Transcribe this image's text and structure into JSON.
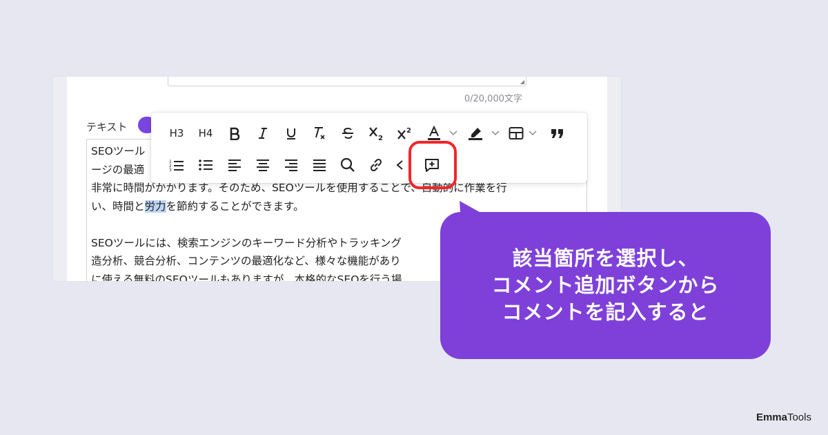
{
  "editor_panel": {
    "char_count": "0/20,000文字",
    "field_label": "テキスト",
    "paragraphs": [
      {
        "lines": [
          "SEOツール",
          "ージの最適",
          "非常に時間がかかります。そのため、SEOツールを使用することで、自動的に作業を行",
          "い、時間と"
        ],
        "highlight": "労力",
        "after": "を節約することができます。"
      },
      {
        "lines": [
          "SEOツールには、検索エンジンのキーワード分析やトラッキング",
          "造分析、競合分析、コンテンツの最適化など、様々な機能があり",
          "に使える無料のSEOツールもありますが、本格的なSEOを行う場"
        ]
      }
    ]
  },
  "toolbar": {
    "row1": [
      {
        "name": "heading-3-button",
        "label": "H3"
      },
      {
        "name": "heading-4-button",
        "label": "H4"
      },
      {
        "name": "bold-button",
        "icon": "bold-icon"
      },
      {
        "name": "italic-button",
        "icon": "italic-icon"
      },
      {
        "name": "underline-button",
        "icon": "underline-icon"
      },
      {
        "name": "clear-format-button",
        "icon": "clear-format-icon"
      },
      {
        "name": "strikethrough-button",
        "icon": "strikethrough-icon"
      },
      {
        "name": "subscript-button",
        "icon": "subscript-icon"
      },
      {
        "name": "superscript-button",
        "icon": "superscript-icon"
      },
      {
        "name": "text-color-button",
        "icon": "text-color-icon"
      },
      {
        "name": "highlight-color-button",
        "icon": "highlighter-icon"
      },
      {
        "name": "table-button",
        "icon": "table-icon"
      },
      {
        "name": "quote-button",
        "icon": "quote-icon"
      }
    ],
    "row2": [
      {
        "name": "ordered-list-button",
        "icon": "ordered-list-icon"
      },
      {
        "name": "bullet-list-button",
        "icon": "bullet-list-icon"
      },
      {
        "name": "align-left-button",
        "icon": "align-left-icon"
      },
      {
        "name": "align-center-button",
        "icon": "align-center-icon"
      },
      {
        "name": "align-right-button",
        "icon": "align-right-icon"
      },
      {
        "name": "align-justify-button",
        "icon": "align-justify-icon"
      },
      {
        "name": "search-button",
        "icon": "search-icon"
      },
      {
        "name": "link-button",
        "icon": "link-icon"
      },
      {
        "name": "code-button",
        "icon": "code-icon"
      },
      {
        "name": "add-comment-button",
        "icon": "comment-add-icon"
      }
    ],
    "labels": {
      "h3": "H3",
      "h4": "H4",
      "text_color_letter": "A"
    },
    "highlight_color": "#f0262a"
  },
  "callout": {
    "lines": [
      "該当箇所を選択し、",
      "コメント追加ボタンから",
      "コメントを記入すると"
    ],
    "color": "#7e40d9"
  },
  "brand": {
    "part1": "Emma",
    "part2": "Tools"
  }
}
